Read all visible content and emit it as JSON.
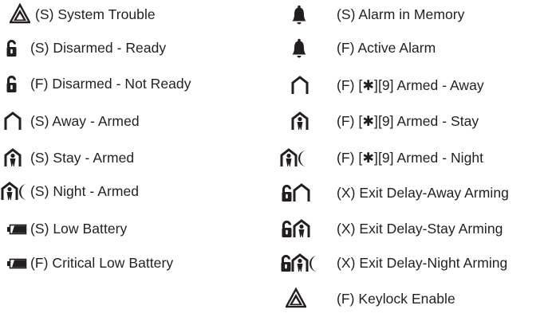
{
  "colors": {
    "text": "#231f20",
    "icon": "#231f20"
  },
  "left_column": [
    {
      "icons": [
        "warning-triangle-icon"
      ],
      "label": "(S) System Trouble"
    },
    {
      "icons": [
        "unlocked-padlock-icon"
      ],
      "label": "(S) Disarmed - Ready"
    },
    {
      "icons": [
        "unlocked-padlock-icon"
      ],
      "label": "(F) Disarmed - Not Ready"
    },
    {
      "icons": [
        "house-away-icon"
      ],
      "label": "(S) Away - Armed"
    },
    {
      "icons": [
        "house-stay-icon"
      ],
      "label": "(S) Stay - Armed"
    },
    {
      "icons": [
        "house-stay-icon",
        "moon-icon"
      ],
      "label": "(S) Night - Armed"
    },
    {
      "icons": [
        "battery-low-icon"
      ],
      "label": "(S) Low Battery"
    },
    {
      "icons": [
        "battery-low-icon"
      ],
      "label": "(F) Critical Low Battery"
    }
  ],
  "right_column": [
    {
      "icons": [
        "bell-icon"
      ],
      "label": "(S) Alarm in Memory"
    },
    {
      "icons": [
        "bell-icon"
      ],
      "label": "(F) Active Alarm"
    },
    {
      "icons": [
        "house-away-icon"
      ],
      "label": "(F) [✱][9] Armed - Away"
    },
    {
      "icons": [
        "house-stay-icon"
      ],
      "label": "(F) [✱][9] Armed - Stay"
    },
    {
      "icons": [
        "house-stay-icon",
        "moon-icon"
      ],
      "label": "(F) [✱][9] Armed - Night"
    },
    {
      "icons": [
        "unlocked-padlock-icon",
        "house-away-icon"
      ],
      "label": "(X) Exit Delay-Away Arming"
    },
    {
      "icons": [
        "unlocked-padlock-icon",
        "house-stay-icon"
      ],
      "label": "(X) Exit Delay-Stay Arming"
    },
    {
      "icons": [
        "unlocked-padlock-icon",
        "house-stay-icon",
        "moon-icon"
      ],
      "label": "(X) Exit Delay-Night Arming"
    },
    {
      "icons": [
        "warning-triangle-icon"
      ],
      "label": "(F) Keylock Enable"
    }
  ]
}
